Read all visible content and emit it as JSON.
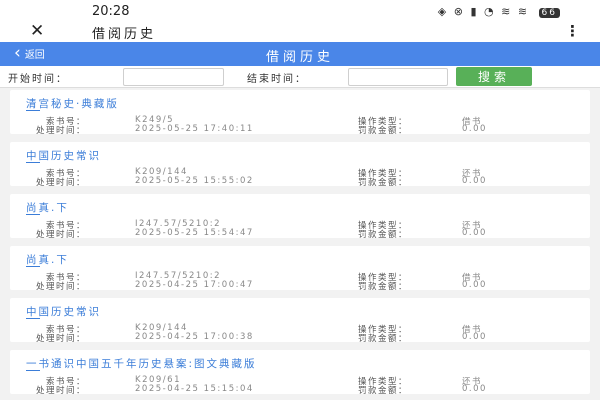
{
  "status": {
    "time": "20:28",
    "icons": "◈ ⊗ ▮ ◔ ≋ ≋",
    "battery": "66"
  },
  "app": {
    "title": "借阅历史",
    "close_icon": "close-icon",
    "menu_icon": "more-vert-icon"
  },
  "nav": {
    "back_label": "返回",
    "title": "借阅历史"
  },
  "search": {
    "start_label": "开始时间：",
    "start_value": "",
    "end_label": "结束时间：",
    "end_value": "",
    "button_label": "搜索"
  },
  "labels": {
    "book_no": "索书号：",
    "time": "处理时间：",
    "op_type": "操作类型：",
    "fine": "罚款金额："
  },
  "records": [
    {
      "title": "清宫秘史·典藏版",
      "book_no": "K249/5",
      "time": "2025-05-25 17:40:11",
      "op_type": "借书",
      "fine": "0.00"
    },
    {
      "title": "中国历史常识",
      "book_no": "K209/144",
      "time": "2025-05-25 15:55:02",
      "op_type": "还书",
      "fine": "0.00"
    },
    {
      "title": "尚真.下",
      "book_no": "I247.57/5210:2",
      "time": "2025-05-25 15:54:47",
      "op_type": "还书",
      "fine": "0.00"
    },
    {
      "title": "尚真.下",
      "book_no": "I247.57/5210:2",
      "time": "2025-04-25 17:00:47",
      "op_type": "借书",
      "fine": "0.00"
    },
    {
      "title": "中国历史常识",
      "book_no": "K209/144",
      "time": "2025-04-25 17:00:38",
      "op_type": "借书",
      "fine": "0.00"
    },
    {
      "title": "一书通识中国五千年历史悬案:图文典藏版",
      "book_no": "K209/61",
      "time": "2025-04-25 15:15:04",
      "op_type": "还书",
      "fine": "0.00"
    }
  ]
}
